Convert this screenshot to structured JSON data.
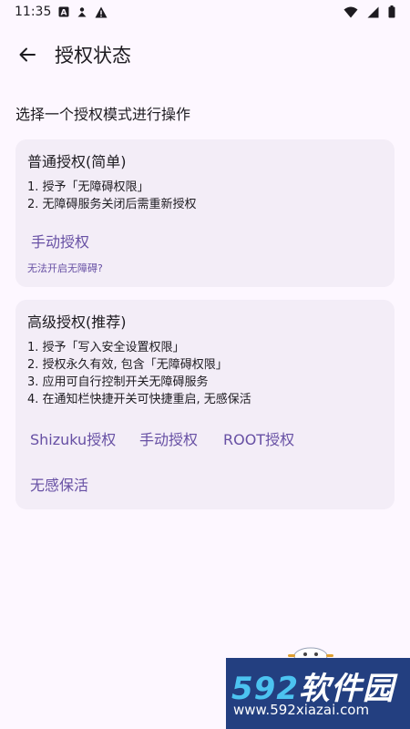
{
  "status_bar": {
    "time": "11:35",
    "left_icons": [
      "a-letter-icon",
      "person-icon",
      "warning-icon"
    ],
    "right_icons": [
      "wifi-icon",
      "cell-signal-icon",
      "battery-icon"
    ]
  },
  "app_bar": {
    "title": "授权状态"
  },
  "subtitle": "选择一个授权模式进行操作",
  "cards": [
    {
      "title": "普通授权(简单)",
      "lines": [
        "1. 授予「无障碍权限」",
        "2. 无障碍服务关闭后需重新授权"
      ],
      "actions": [
        "手动授权"
      ],
      "link": "无法开启无障碍?"
    },
    {
      "title": "高级授权(推荐)",
      "lines": [
        "1. 授予「写入安全设置权限」",
        "2. 授权永久有效, 包含「无障碍权限」",
        "3. 应用可自行控制开关无障碍服务",
        "4. 在通知栏快捷开关可快捷重启, 无感保活"
      ],
      "actions": [
        "Shizuku授权",
        "手动授权",
        "ROOT授权",
        "无感保活"
      ]
    }
  ],
  "watermark": {
    "brand_digits": "592",
    "brand_text": "软件园",
    "url": "www.592xiazai.com"
  },
  "colors": {
    "background": "#FDF7FF",
    "card": "#F3EDF7",
    "accent": "#6750A4",
    "watermark_bg": "#233F80",
    "watermark_accent": "#4CC3F0"
  }
}
